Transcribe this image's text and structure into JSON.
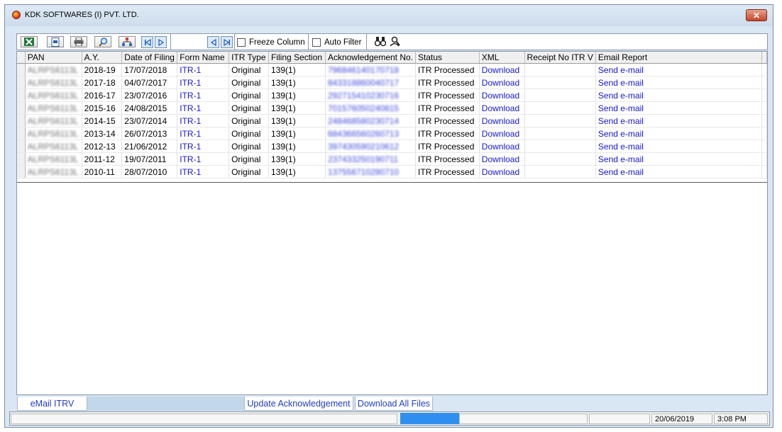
{
  "window": {
    "title": "KDK SOFTWARES (I) PVT. LTD.",
    "close_label": "✕"
  },
  "toolbar": {
    "freeze_column_label": "Freeze Column",
    "auto_filter_label": "Auto Filter"
  },
  "grid": {
    "columns": [
      "PAN",
      "A.Y.",
      "Date of Filing",
      "Form Name",
      "ITR Type",
      "Filing Section",
      "Acknowledgement No.",
      "Status",
      "XML",
      "Receipt No ITR V",
      "Email Report"
    ],
    "rows": [
      {
        "pan": "ALRPS6113L",
        "ay": "2018-19",
        "date": "17/07/2018",
        "form": "ITR-1",
        "type": "Original",
        "section": "139(1)",
        "ack": "796846140170718",
        "status": "ITR Processed",
        "xml": "Download",
        "receipt": "",
        "email": "Send e-mail"
      },
      {
        "pan": "ALRPS6113L",
        "ay": "2017-18",
        "date": "04/07/2017",
        "form": "ITR-1",
        "type": "Original",
        "section": "139(1)",
        "ack": "843318860040717",
        "status": "ITR Processed",
        "xml": "Download",
        "receipt": "",
        "email": "Send e-mail"
      },
      {
        "pan": "ALRPS6113L",
        "ay": "2016-17",
        "date": "23/07/2016",
        "form": "ITR-1",
        "type": "Original",
        "section": "139(1)",
        "ack": "292715410230716",
        "status": "ITR Processed",
        "xml": "Download",
        "receipt": "",
        "email": "Send e-mail"
      },
      {
        "pan": "ALRPS6113L",
        "ay": "2015-16",
        "date": "24/08/2015",
        "form": "ITR-1",
        "type": "Original",
        "section": "139(1)",
        "ack": "701576050240815",
        "status": "ITR Processed",
        "xml": "Download",
        "receipt": "",
        "email": "Send e-mail"
      },
      {
        "pan": "ALRPS6113L",
        "ay": "2014-15",
        "date": "23/07/2014",
        "form": "ITR-1",
        "type": "Original",
        "section": "139(1)",
        "ack": "248468580230714",
        "status": "ITR Processed",
        "xml": "Download",
        "receipt": "",
        "email": "Send e-mail"
      },
      {
        "pan": "ALRPS6113L",
        "ay": "2013-14",
        "date": "26/07/2013",
        "form": "ITR-1",
        "type": "Original",
        "section": "139(1)",
        "ack": "684366560260713",
        "status": "ITR Processed",
        "xml": "Download",
        "receipt": "",
        "email": "Send e-mail"
      },
      {
        "pan": "ALRPS6113L",
        "ay": "2012-13",
        "date": "21/06/2012",
        "form": "ITR-1",
        "type": "Original",
        "section": "139(1)",
        "ack": "397430590210612",
        "status": "ITR Processed",
        "xml": "Download",
        "receipt": "",
        "email": "Send e-mail"
      },
      {
        "pan": "ALRPS6113L",
        "ay": "2011-12",
        "date": "19/07/2011",
        "form": "ITR-1",
        "type": "Original",
        "section": "139(1)",
        "ack": "237433250190711",
        "status": "ITR Processed",
        "xml": "Download",
        "receipt": "",
        "email": "Send e-mail"
      },
      {
        "pan": "ALRPS6113L",
        "ay": "2010-11",
        "date": "28/07/2010",
        "form": "ITR-1",
        "type": "Original",
        "section": "139(1)",
        "ack": "137556710280710",
        "status": "ITR Processed",
        "xml": "Download",
        "receipt": "",
        "email": "Send e-mail"
      }
    ]
  },
  "tabs": {
    "email_itrv": "eMail ITRV",
    "update_ack": "Update Acknowledgement",
    "download_all": "Download All Files"
  },
  "statusbar": {
    "date": "20/06/2019",
    "time": "3:08 PM"
  }
}
